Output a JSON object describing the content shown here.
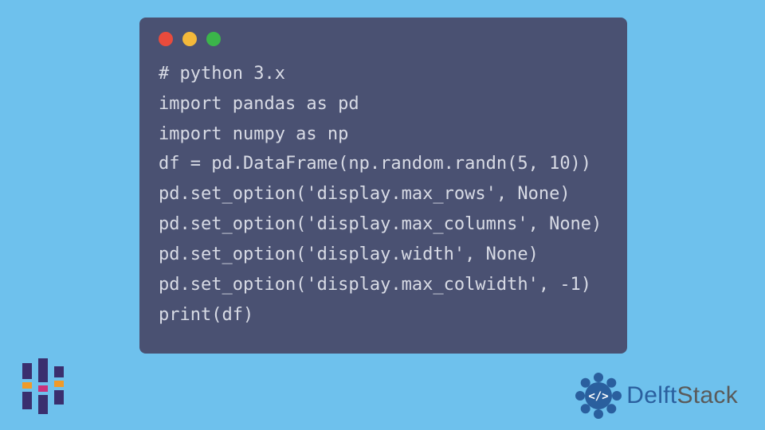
{
  "codeWindow": {
    "lines": [
      "# python 3.x",
      "import pandas as pd",
      "import numpy as np",
      "df = pd.DataFrame(np.random.randn(5, 10))",
      "pd.set_option('display.max_rows', None)",
      "pd.set_option('display.max_columns', None)",
      "pd.set_option('display.width', None)",
      "pd.set_option('display.max_colwidth', -1)",
      "print(df)"
    ]
  },
  "brand": {
    "name1": "Delft",
    "name2": "Stack"
  },
  "colors": {
    "page_bg": "#6ec1ed",
    "window_bg": "#4a5172",
    "code_fg": "#d8dbe5",
    "dot_red": "#e94b3c",
    "dot_yellow": "#f4b93a",
    "dot_green": "#3bb54a",
    "brand_blue": "#2a5f9e",
    "brand_grey": "#5a5a5a",
    "icon_purple": "#3a2f6e",
    "icon_orange": "#f09b2a",
    "icon_magenta": "#c9327b"
  }
}
